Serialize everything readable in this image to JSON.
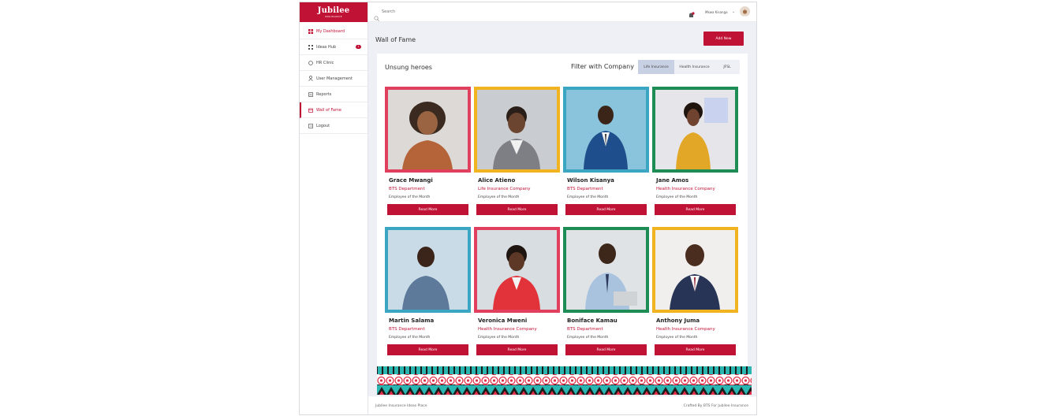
{
  "brand": {
    "name": "Jubilee",
    "tagline": "INSURANCE",
    "color": "#c01235"
  },
  "sidebar": {
    "items": [
      {
        "label": "My Dashboard",
        "icon": "dashboard-icon"
      },
      {
        "label": "Ideas Hub",
        "icon": "grid-icon",
        "badge": "1"
      },
      {
        "label": "HR Clinic",
        "icon": "chat-icon"
      },
      {
        "label": "User Management",
        "icon": "user-icon"
      },
      {
        "label": "Reports",
        "icon": "reports-icon"
      },
      {
        "label": "Wall of Fame",
        "icon": "calendar-icon"
      },
      {
        "label": "Logout",
        "icon": "logout-icon"
      }
    ]
  },
  "topbar": {
    "search_placeholder": "Search",
    "user_name": "Mkwa Kisanga"
  },
  "main": {
    "title": "Wall of Fame",
    "add_button": "Add New",
    "panel_title": "Unsung heroes",
    "filter_label": "Filter with Company",
    "filter_tabs": [
      "Life Insurance",
      "Health Insurance",
      "JFSL"
    ],
    "selected_tab": "Life Insurance",
    "people": [
      {
        "name": "Grace Mwangi",
        "dept": "BTS Department",
        "award": "Employee of the Month",
        "button": "Read More",
        "frame": "#e0405e"
      },
      {
        "name": "Alice Atieno",
        "dept": "Life Insurance Company",
        "award": "Employee of the Month",
        "button": "Read More",
        "frame": "#f2b320"
      },
      {
        "name": "Wilson Kisanya",
        "dept": "BTS Department",
        "award": "Employee of the Month",
        "button": "Read More",
        "frame": "#3aa6c2"
      },
      {
        "name": "Jane Amos",
        "dept": "Health Insurance Company",
        "award": "Employee of the Month",
        "button": "Read More",
        "frame": "#1e8c55"
      },
      {
        "name": "Martin Salama",
        "dept": "BTS Department",
        "award": "Employee of the Month",
        "button": "Read More",
        "frame": "#3aa6c2"
      },
      {
        "name": "Veronica Mweni",
        "dept": "Health Insurance Company",
        "award": "Employee of the Month",
        "button": "Read More",
        "frame": "#e0405e"
      },
      {
        "name": "Boniface Kamau",
        "dept": "BTS Department",
        "award": "Employee of the Month",
        "button": "Read More",
        "frame": "#1e8c55"
      },
      {
        "name": "Anthony Juma",
        "dept": "Health Insurance Company",
        "award": "Employee of the Month",
        "button": "Read More",
        "frame": "#f2b320"
      }
    ]
  },
  "footer": {
    "left": "Jubilee Insurance Ideas Place",
    "right": "Crafted By BTS For Jubilee Insurance"
  }
}
